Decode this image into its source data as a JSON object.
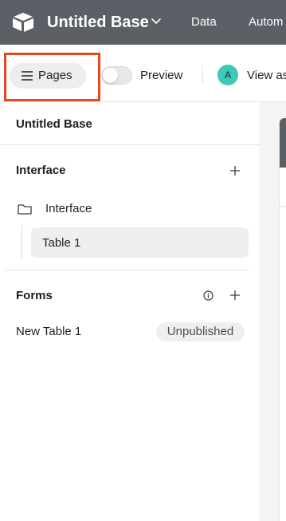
{
  "header": {
    "base_name": "Untitled Base",
    "nav": [
      "Data",
      "Autom"
    ]
  },
  "toolbar": {
    "pages_label": "Pages",
    "preview_label": "Preview",
    "preview_on": false,
    "avatar_initial": "A",
    "view_as_label": "View as"
  },
  "sidebar": {
    "title": "Untitled Base",
    "interface_section": {
      "title": "Interface",
      "folder_label": "Interface",
      "pages": [
        "Table 1"
      ]
    },
    "forms_section": {
      "title": "Forms",
      "items": [
        {
          "label": "New Table 1",
          "status": "Unpublished"
        }
      ]
    }
  },
  "colors": {
    "header_bg": "#5b5f66",
    "highlight": "#e5471f",
    "avatar": "#3cc9b5"
  }
}
